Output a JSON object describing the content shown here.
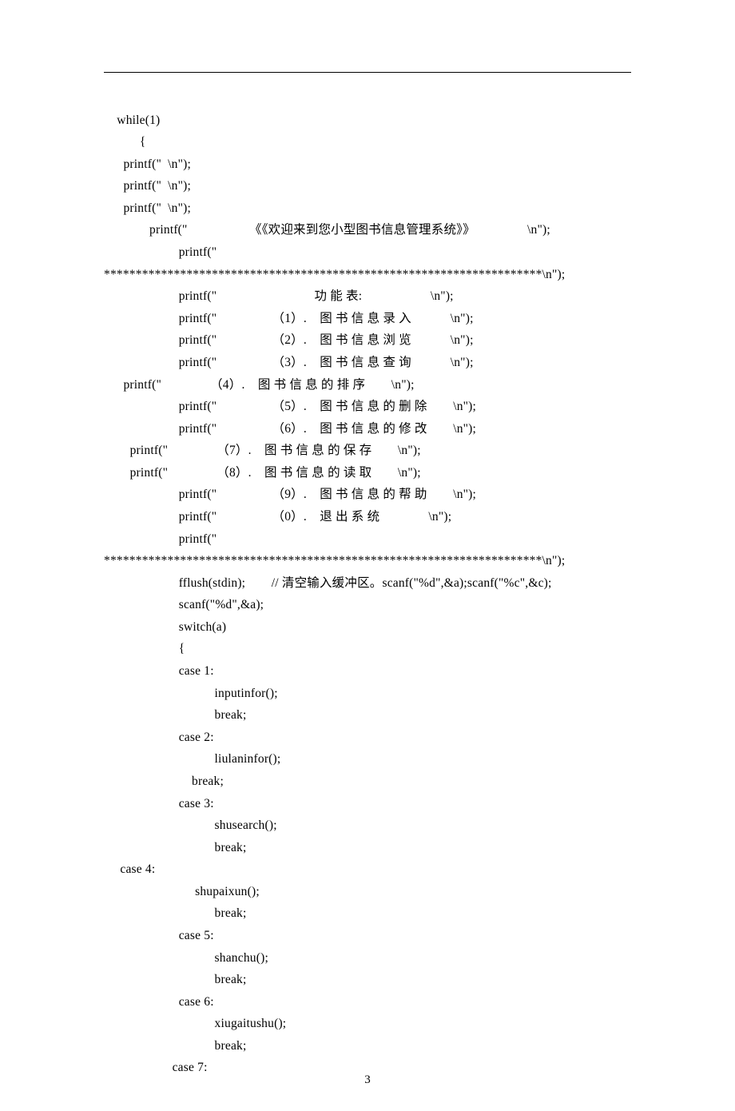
{
  "lines": {
    "l00": "    while(1)",
    "l01": "           {",
    "l02": "      printf(\"  \\n\");",
    "l03": "      printf(\"  \\n\");",
    "l04": "      printf(\"  \\n\");",
    "l05": "              printf(\"                   《《欢迎来到您小型图书信息管理系统》》                \\n\");",
    "l06": "                       printf(\"",
    "l07": "*********************************************************************\\n\");",
    "l08": "                       printf(\"                              功 能 表:                     \\n\");",
    "l09": "                       printf(\"                 （1）.    图 书 信 息 录 入            \\n\");",
    "l10": "                       printf(\"                 （2）.    图 书 信 息 浏 览            \\n\");",
    "l11": "                       printf(\"                 （3）.    图 书 信 息 查 询            \\n\");",
    "l12": "      printf(\"               （4）.    图 书 信 息 的 排 序        \\n\");",
    "l13": "                       printf(\"                 （5）.    图 书 信 息 的 删 除        \\n\");",
    "l14": "                       printf(\"                 （6）.    图 书 信 息 的 修 改        \\n\");",
    "l15": "        printf(\"               （7）.    图 书 信 息 的 保 存        \\n\");",
    "l16": "        printf(\"               （8）.    图 书 信 息 的 读 取        \\n\");",
    "l17": "                       printf(\"                 （9）.    图 书 信 息 的 帮 助        \\n\");",
    "l18": "                       printf(\"                 （0）.    退 出 系 统               \\n\");",
    "l19": "                       printf(\"",
    "l20": "*********************************************************************\\n\");",
    "l21": "                       fflush(stdin);        // 清空输入缓冲区。scanf(\"%d\",&a);scanf(\"%c\",&c);",
    "l22": "                       scanf(\"%d\",&a);",
    "l23": "                       switch(a)",
    "l24": "                       {",
    "l25": "                       case 1:",
    "l26": "                                  inputinfor();",
    "l27": "                                  break;",
    "l28": "                       case 2:",
    "l29": "                                  liulaninfor();",
    "l30": "                           break;",
    "l31": "                       case 3:",
    "l32": "                                  shusearch();",
    "l33": "                                  break;",
    "l34": "     case 4:",
    "l35": "                            shupaixun();",
    "l36": "                                  break;",
    "l37": "                       case 5:",
    "l38": "                                  shanchu();",
    "l39": "                                  break;",
    "l40": "                       case 6:",
    "l41": "                                  xiugaitushu();",
    "l42": "                                  break;",
    "l43": "                     case 7:"
  },
  "page_number": "3"
}
